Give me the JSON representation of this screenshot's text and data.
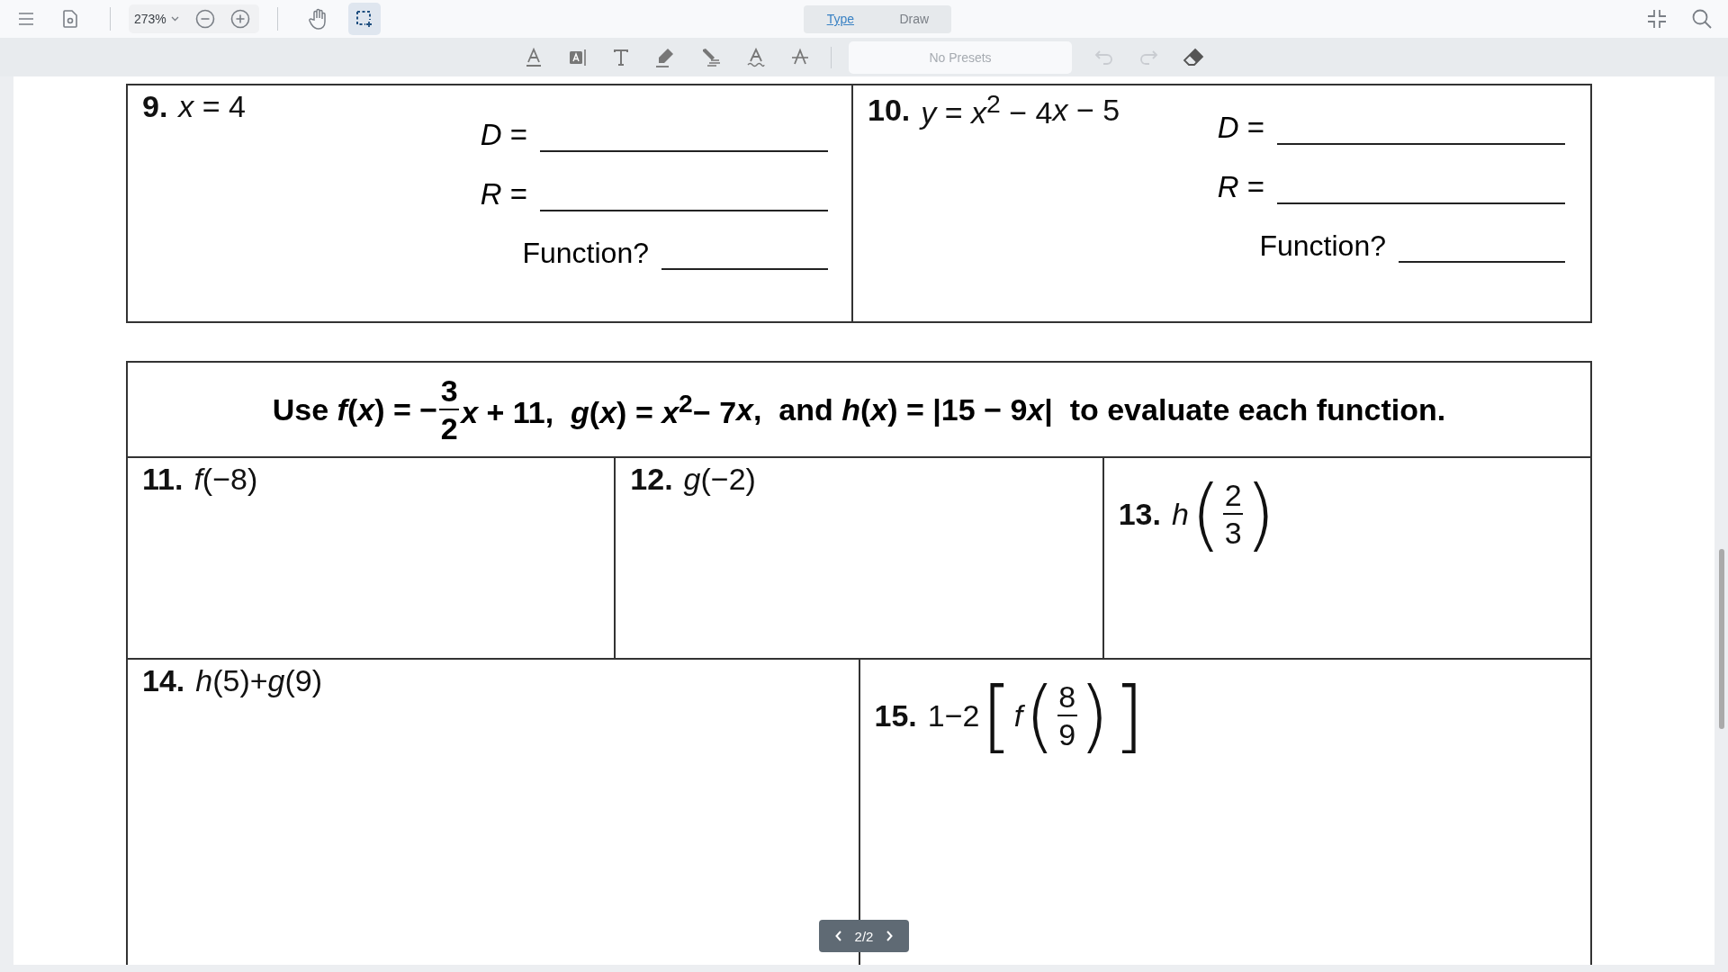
{
  "toolbar": {
    "zoom": "273%",
    "tabs": [
      {
        "label": "Type",
        "selected": true
      },
      {
        "label": "Draw",
        "selected": false
      }
    ],
    "presets": {
      "placeholder": "No Presets"
    }
  },
  "worksheet": {
    "top_problems": [
      {
        "number": "9.",
        "expression": [
          {
            "kind": "text",
            "text": "*x* = 4"
          }
        ],
        "domain_label": "*D* =",
        "range_label": "*R* =",
        "function_label": "Function?"
      },
      {
        "number": "10.",
        "expression": [
          {
            "kind": "text",
            "text": "*y* = *x*$^{2}$ − 4"
          },
          {
            "kind": "text",
            "text": "*x*"
          },
          {
            "kind": "text",
            "text": " − 5"
          }
        ],
        "domain_label": "*D* =",
        "range_label": "*R* =",
        "function_label": "Function?"
      }
    ],
    "instructions": [
      {
        "kind": "text",
        "text": "Use *f*(*x*) = −"
      },
      {
        "kind": "fraction",
        "num": "3",
        "den": "2"
      },
      {
        "kind": "text",
        "text": "*x* + 11,  *g*(*x*) = *x*$^{2}$− 7"
      },
      {
        "kind": "text",
        "text": "*x*"
      },
      {
        "kind": "text",
        "text": ",  and *h*(*x*) = |15 − 9"
      },
      {
        "kind": "text",
        "text": "*x*"
      },
      {
        "kind": "text",
        "text": "|  to evaluate each function."
      }
    ],
    "rows": [
      [
        {
          "number": "11.",
          "expression": [
            {
              "kind": "text",
              "text": "*f*(−8)"
            }
          ]
        },
        {
          "number": "12.",
          "expression": [
            {
              "kind": "text",
              "text": "*g*(−2)"
            }
          ]
        },
        {
          "number": "13.",
          "expression": [
            {
              "kind": "text",
              "text": "*h*"
            },
            {
              "kind": "big",
              "text": "("
            },
            {
              "kind": "fraction",
              "num": "2",
              "den": "3"
            },
            {
              "kind": "big",
              "text": ")"
            }
          ]
        }
      ],
      [
        {
          "number": "14.",
          "expression": [
            {
              "kind": "text",
              "text": "*h*(5)+*g*(9)"
            }
          ]
        },
        {
          "number": "15.",
          "expression": [
            {
              "kind": "text",
              "text": "1−2"
            },
            {
              "kind": "big",
              "text": "["
            },
            {
              "kind": "text",
              "text": "*f*"
            },
            {
              "kind": "big",
              "text": "("
            },
            {
              "kind": "fraction",
              "num": "8",
              "den": "9"
            },
            {
              "kind": "big",
              "text": ")"
            },
            {
              "kind": "big",
              "text": "]"
            }
          ]
        }
      ]
    ]
  },
  "pager": {
    "page": "2/2"
  }
}
